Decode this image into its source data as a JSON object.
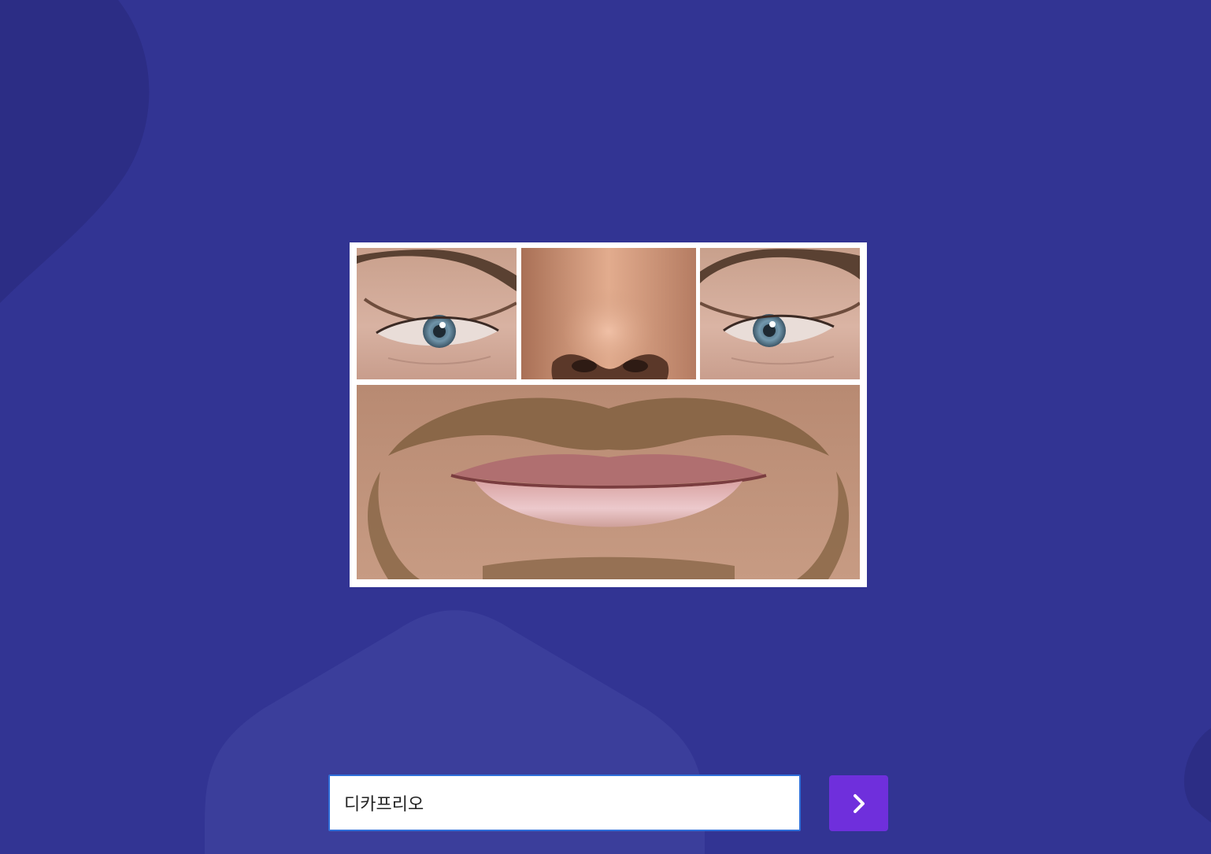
{
  "colors": {
    "background": "#323493",
    "frame": "#ffffff",
    "input_border": "#2f6fd9",
    "submit_button": "#6f2fdc"
  },
  "puzzle": {
    "pieces": [
      "left-eye",
      "nose",
      "right-eye",
      "mouth"
    ]
  },
  "answer": {
    "value": "디카프리오",
    "placeholder": ""
  },
  "submit": {
    "icon": "chevron-right-icon"
  }
}
